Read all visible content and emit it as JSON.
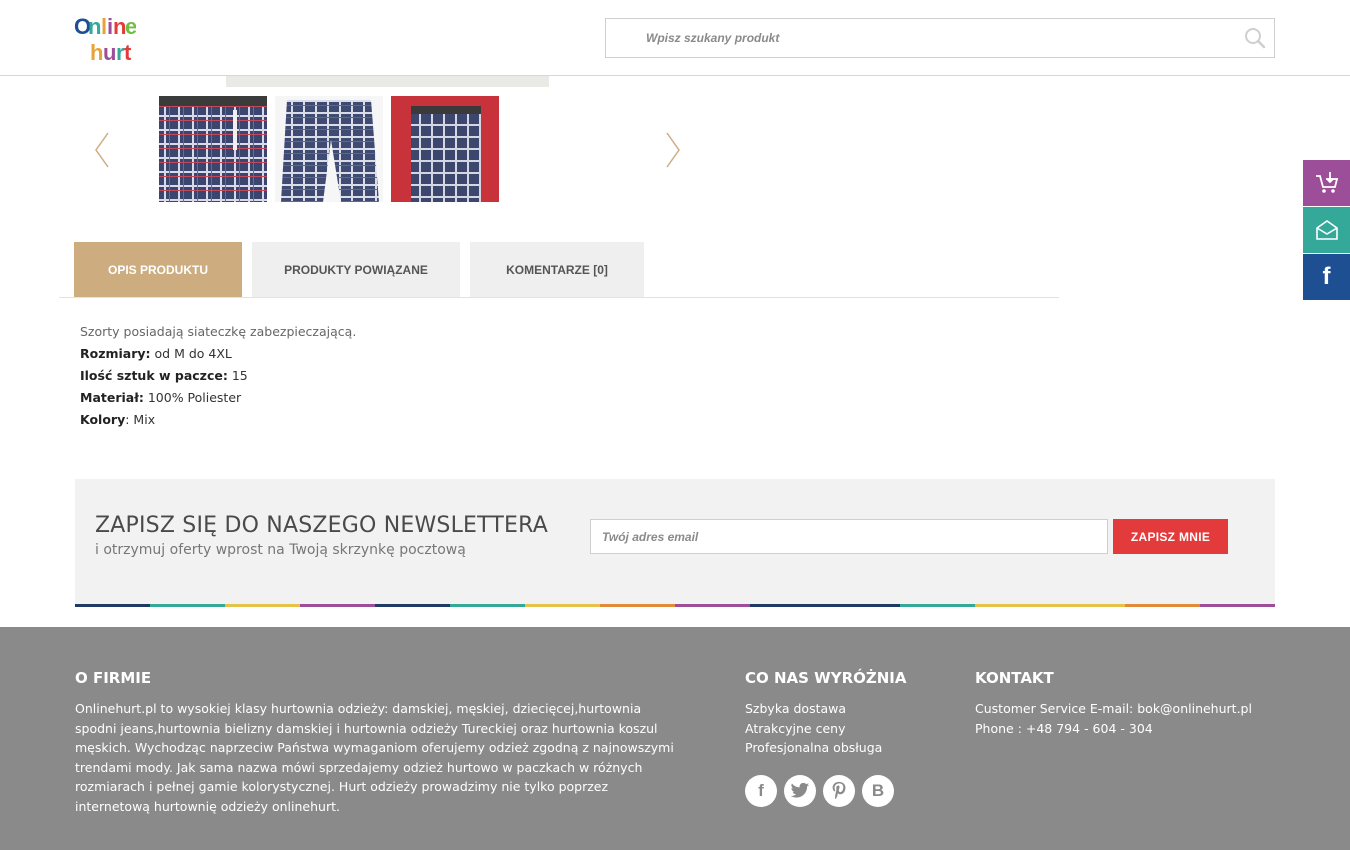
{
  "header": {
    "logo_text": "Online hurt",
    "search_placeholder": "Wpisz szukany produkt"
  },
  "tabs": [
    {
      "label": "OPIS PRODUKTU",
      "active": true
    },
    {
      "label": "PRODUKTY POWIĄZANE",
      "active": false
    },
    {
      "label": "KOMENTARZE [0]",
      "active": false
    }
  ],
  "description": {
    "intro": "Szorty posiadają siateczkę zabezpieczającą.",
    "rows": [
      {
        "label": "Rozmiary:",
        "value": " od M do 4XL"
      },
      {
        "label": "Ilość sztuk w paczce:",
        "value": " 15"
      },
      {
        "label": "Materiał:",
        "value": " 100% Poliester"
      },
      {
        "label": "Kolory",
        "value": ": Mix"
      }
    ]
  },
  "newsletter": {
    "title": "ZAPISZ SIĘ DO NASZEGO NEWSLETTERA",
    "subtitle": "i otrzymuj oferty wprost na Twoją skrzynkę pocztową",
    "email_placeholder": "Twój adres email",
    "button_label": "ZAPISZ MNIE"
  },
  "footer": {
    "about": {
      "title": "O FIRMIE",
      "text": "Onlinehurt.pl to wysokiej klasy hurtownia odzieży: damskiej, męskiej, dziecięcej,hurtownia spodni jeans,hurtownia bielizny damskiej i hurtownia odzieży Tureckiej oraz hurtownia koszul męskich. Wychodząc naprzeciw Państwa wymaganiom oferujemy odzież zgodną z najnowszymi trendami mody. Jak sama nazwa mówi sprzedajemy odzież hurtowo w paczkach w różnych rozmiarach i pełnej gamie kolorystycznej. Hurt odzieży prowadzimy nie tylko poprzez internetową hurtownię odzieży onlinehurt."
    },
    "features": {
      "title": "CO NAS WYRÓŻNIA",
      "items": [
        "Szbyka dostawa",
        "Atrakcyjne ceny",
        "Profesjonalna obsługa"
      ]
    },
    "contact": {
      "title": "KONTAKT",
      "email_line": "Customer Service E-mail: bok@onlinehurt.pl",
      "phone_line": "Phone : +48 794 - 604 - 304"
    },
    "social_icons": [
      "facebook-icon",
      "twitter-icon",
      "pinterest-icon",
      "b-icon"
    ]
  },
  "side_buttons": [
    "cart-icon",
    "mail-icon",
    "facebook-icon"
  ],
  "colors": {
    "tab_active": "#cdad80",
    "tab_inactive": "#efefef",
    "newsletter_button": "#e33b3b",
    "footer_bg": "#8a8a8a",
    "side_cart": "#9c4e98",
    "side_mail": "#34a99a",
    "side_fb": "#1f4f93"
  }
}
